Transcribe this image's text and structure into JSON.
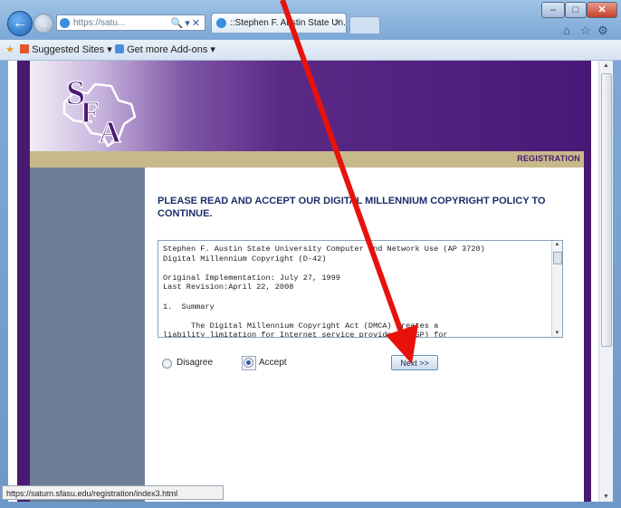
{
  "browser": {
    "address_text": "https://satu...",
    "tab_title": "::Stephen F. Austin State Un...",
    "favorites": [
      {
        "label": "Suggested Sites ▾"
      },
      {
        "label": "Get more Add-ons ▾"
      }
    ],
    "status_url": "https://saturn.sfasu.edu/registration/index3.html"
  },
  "page": {
    "logo_text": "SFA",
    "section_label": "REGISTRATION",
    "heading": "PLEASE READ AND ACCEPT OUR DIGITAL MILLENNIUM COPYRIGHT POLICY TO CONTINUE.",
    "policy_text": "Stephen F. Austin State University Computer and Network Use (AP 3720)\nDigital Millennium Copyright (D-42)\n\nOriginal Implementation: July 27, 1999\nLast Revision:April 22, 2008\n\n1.  Summary\n\n      The Digital Millennium Copyright Act (DMCA) creates a\nliability limitation for Internet service providers (ISP) for",
    "options": {
      "disagree": "Disagree",
      "accept": "Accept",
      "selected": "accept"
    },
    "next_label": "Next >>"
  },
  "colors": {
    "page_purple": "#4a1a73",
    "reg_bar": "#c8b98a",
    "left_column": "#6d7f96",
    "annotation_arrow": "#e8120c"
  }
}
